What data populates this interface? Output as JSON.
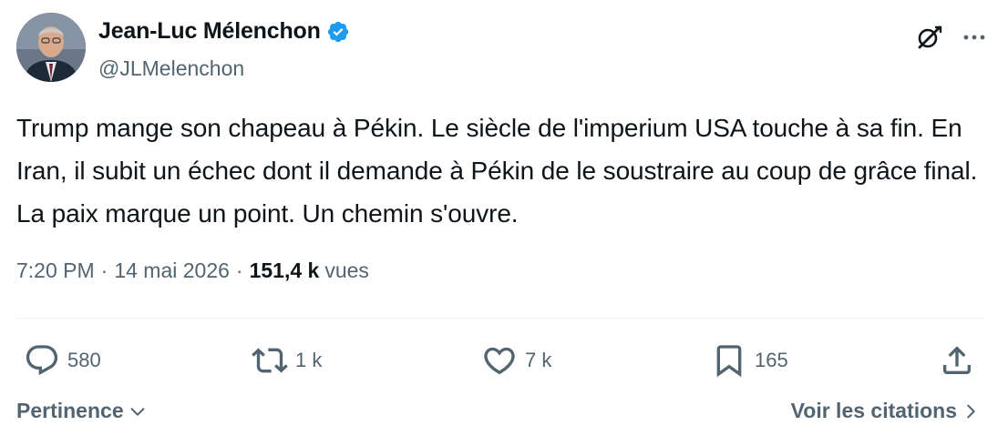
{
  "author": {
    "display_name": "Jean-Luc Mélenchon",
    "handle": "@JLMelenchon",
    "verified": true,
    "verified_color": "#1d9bf0"
  },
  "header_icons": [
    "grok-icon",
    "more-icon"
  ],
  "tweet": {
    "text": "Trump mange son chapeau à Pékin. Le siècle de l'imperium USA touche à sa fin. En Iran, il subit un échec dont il demande à Pékin de le soustraire au coup de grâce final. La paix marque un point. Un chemin s'ouvre."
  },
  "meta": {
    "time": "7:20 PM",
    "separator": "·",
    "date": "14 mai 2026",
    "views_count": "151,4 k",
    "views_label": "vues"
  },
  "actions": {
    "replies": "580",
    "reposts": "1 k",
    "likes": "7 k",
    "bookmarks": "165"
  },
  "footer": {
    "sort_label": "Pertinence",
    "quotes_label": "Voir les citations"
  },
  "colors": {
    "text": "#0f1419",
    "secondary": "#536471",
    "divider": "#eff3f4"
  }
}
